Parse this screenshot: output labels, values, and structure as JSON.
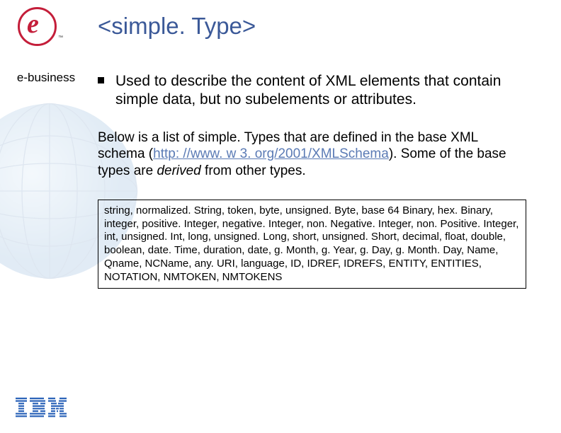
{
  "sidebar": {
    "label": "e-business"
  },
  "title": "<simple. Type>",
  "bullet": "Used to describe the content of XML elements that contain simple data, but no subelements or attributes.",
  "description": {
    "pre": "Below is a list of simple. Types that are defined in the base XML schema (",
    "link": "http: //www. w 3. org/2001/XMLSchema",
    "mid": "). Some of the base types are ",
    "italic": "derived",
    "post": " from other types."
  },
  "types_box": "string, normalized. String, token, byte, unsigned. Byte, base 64 Binary, hex. Binary, integer, positive. Integer, negative. Integer, non. Negative. Integer, non. Positive. Integer, int, unsigned. Int, long, unsigned. Long, short, unsigned. Short, decimal, float, double, boolean, date. Time, duration, date, g. Month, g. Year, g. Day, g. Month. Day, Name, Qname, NCName, any. URI, language, ID, IDREF, IDREFS, ENTITY, ENTITIES, NOTATION, NMTOKEN, NMTOKENS",
  "colors": {
    "title": "#3b5998",
    "link": "#5b7bb5",
    "logo_red": "#c41e3a",
    "ibm_blue": "#2a62b8"
  }
}
